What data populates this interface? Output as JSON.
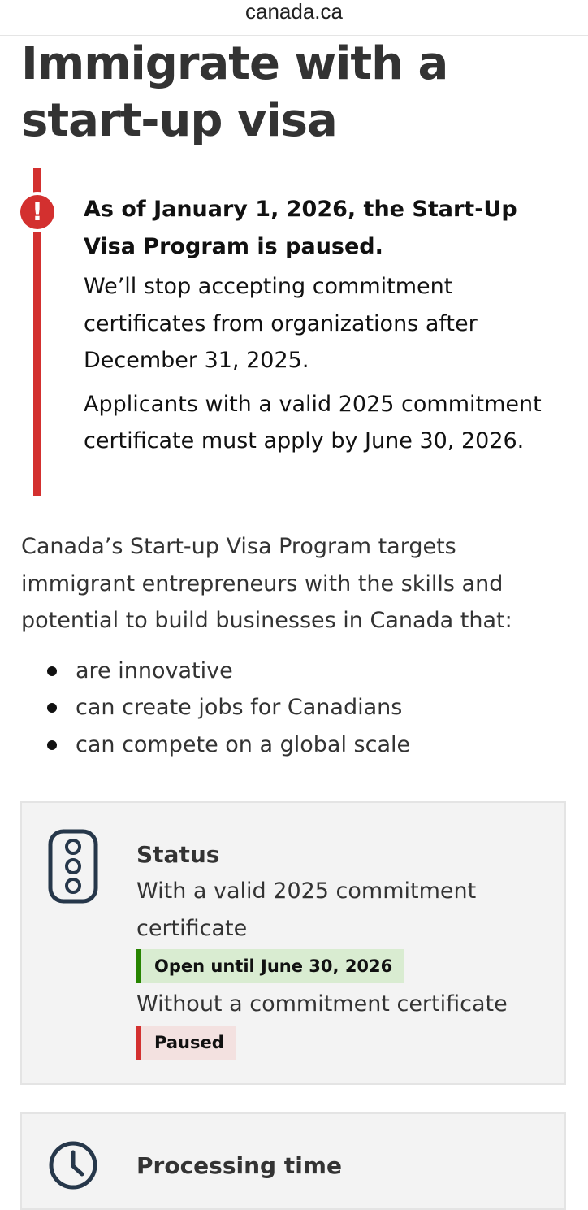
{
  "browser": {
    "url": "canada.ca"
  },
  "page": {
    "title": "Immigrate with a start-up visa"
  },
  "alert": {
    "icon": "exclamation-icon",
    "color": "#d3302f",
    "heading": "As of January 1, 2026, the Start-Up Visa Program is paused.",
    "paragraph1": "We’ll stop accepting commitment certificates from organizations after December 31, 2025.",
    "paragraph2": "Applicants with a valid 2025 commitment certificate must apply by June 30, 2026."
  },
  "intro": {
    "text": "Canada’s Start-up Visa Program targets immigrant entrepreneurs with the skills and potential to build businesses in Canada that:",
    "bullets": [
      "are innovative",
      "can create jobs for Canadians",
      "can compete on a global scale"
    ]
  },
  "status_card": {
    "icon": "traffic-light-icon",
    "title": "Status",
    "line1": "With a valid 2025 commitment certificate",
    "badge1": "Open until June 30, 2026",
    "badge1_color": "#278400",
    "line2": "Without a commitment certificate",
    "badge2": "Paused",
    "badge2_color": "#d3302f"
  },
  "processing_card": {
    "icon": "clock-icon",
    "title": "Processing time"
  }
}
